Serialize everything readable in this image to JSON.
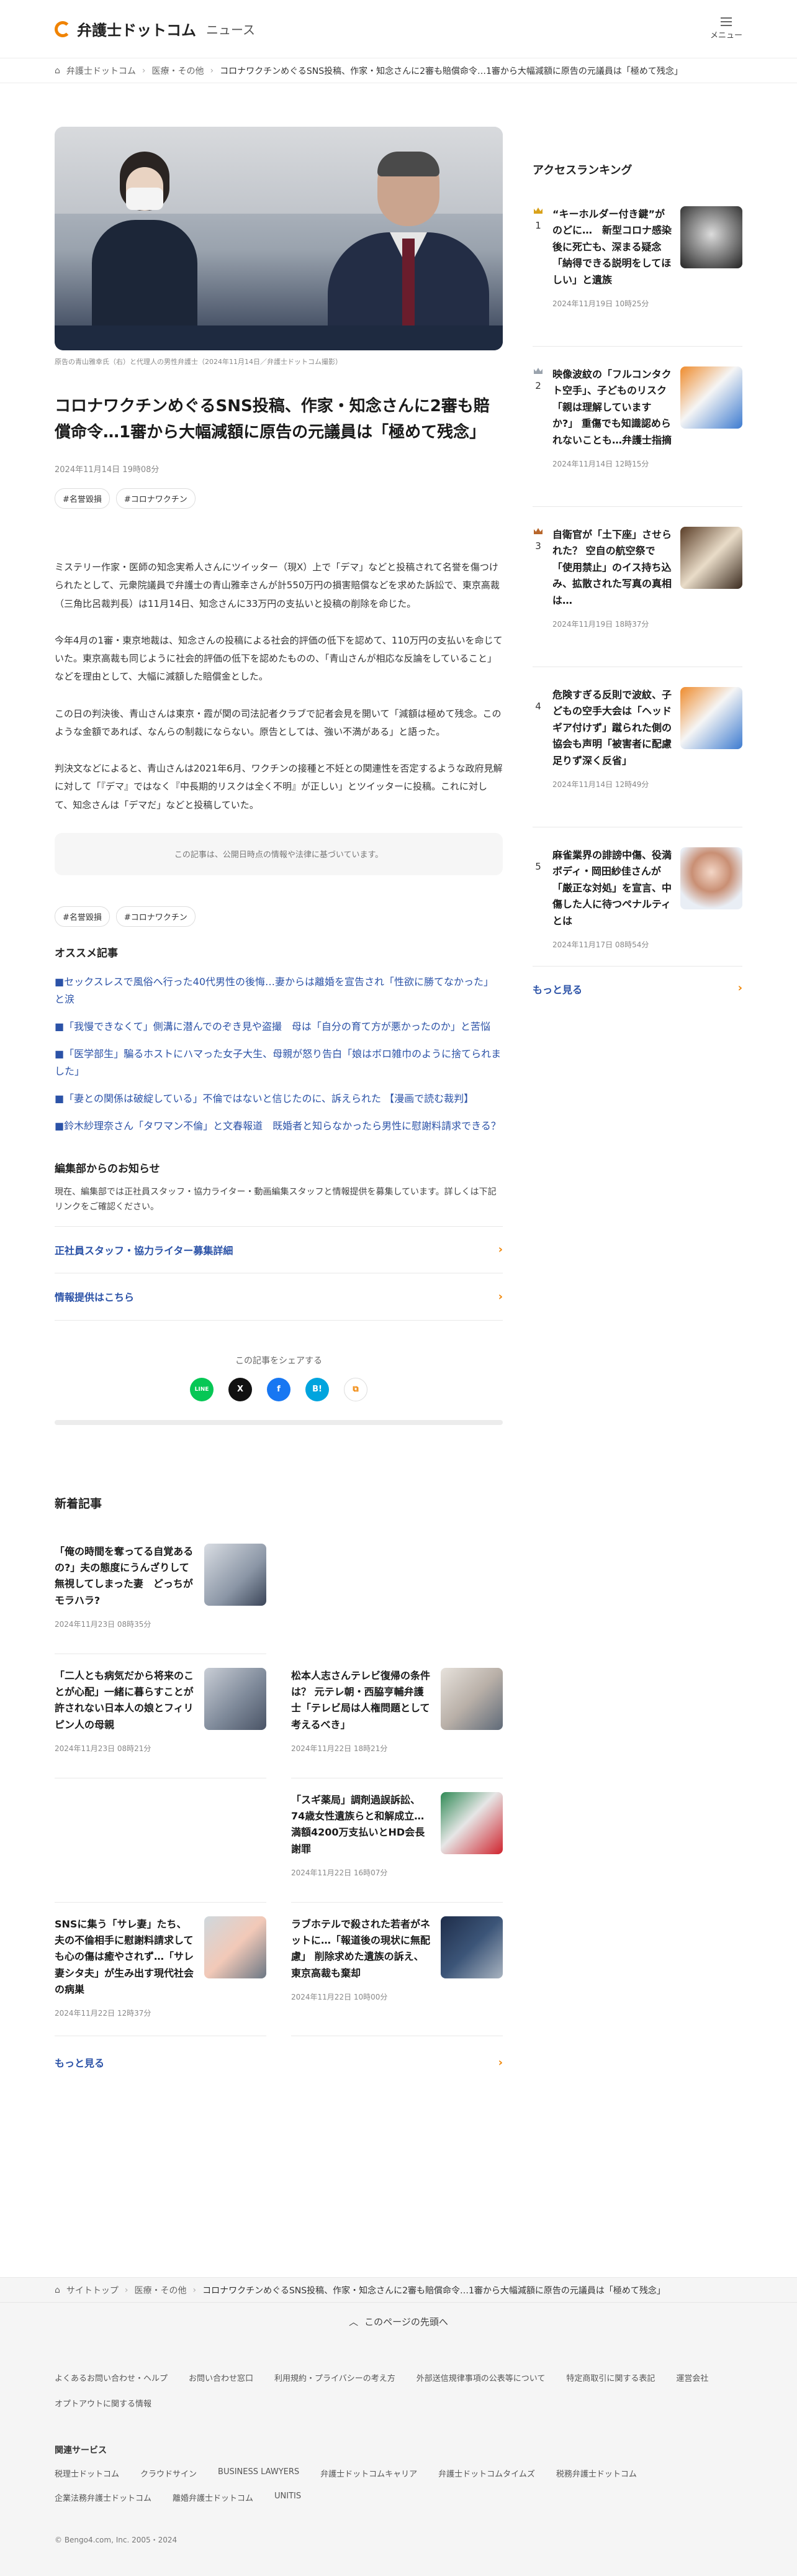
{
  "header": {
    "logo": "弁護士ドットコム",
    "logo_sub": "ニュース",
    "menu_label": "メニュー"
  },
  "breadcrumb": [
    "弁護士ドットコム",
    "医療・その他",
    "コロナワクチンめぐるSNS投稿、作家・知念さんに2審も賠償命令…1審から大幅減額に原告の元議員は「極めて残念」"
  ],
  "article": {
    "caption": "原告の青山雅幸氏（右）と代理人の男性弁護士（2024年11月14日／弁護士ドットコム撮影）",
    "title": "コロナワクチンめぐるSNS投稿、作家・知念さんに2審も賠償命令…1審から大幅減額に原告の元議員は「極めて残念」",
    "date": "2024年11月14日 19時08分",
    "tags": [
      "#名誉毀損",
      "#コロナワクチン"
    ],
    "paragraphs": [
      "ミステリー作家・医師の知念実希人さんにツイッター（現X）上で「デマ」などと投稿されて名誉を傷つけられたとして、元衆院議員で弁護士の青山雅幸さんが計550万円の損害賠償などを求めた訴訟で、東京高裁（三角比呂裁判長）は11月14日、知念さんに33万円の支払いと投稿の削除を命じた。",
      "今年4月の1審・東京地裁は、知念さんの投稿による社会的評価の低下を認めて、110万円の支払いを命じていた。東京高裁も同じように社会的評価の低下を認めたものの、「青山さんが相応な反論をしていること」などを理由として、大幅に減額した賠償金とした。",
      "この日の判決後、青山さんは東京・霞が関の司法記者クラブで記者会見を開いて「減額は極めて残念。このような金額であれば、なんらの制裁にならない。原告としては、強い不満がある」と語った。",
      "判決文などによると、青山さんは2021年6月、ワクチンの接種と不妊との関連性を否定するような政府見解に対して「『デマ』ではなく『中長期的リスクは全く不明』が正しい」とツイッターに投稿。これに対して、知念さんは「デマだ」などと投稿していた。"
    ],
    "notice": "この記事は、公開日時点の情報や法律に基づいています。"
  },
  "recommend": {
    "title": "オススメ記事",
    "items": [
      "■セックスレスで風俗へ行った40代男性の後悔…妻からは離婚を宣告され「性欲に勝てなかった」と涙",
      "■「我慢できなくて」側溝に潜んでのぞき見や盗撮　母は「自分の育て方が悪かったのか」と苦悩",
      "■「医学部生」騙るホストにハマった女子大生、母親が怒り告白「娘はボロ雑巾のように捨てられました」",
      "■「妻との関係は破綻している」不倫ではないと信じたのに、訴えられた 【漫画で読む裁判】",
      "■鈴木紗理奈さん「タワマン不倫」と文春報道　既婚者と知らなかったら男性に慰謝料請求できる？"
    ]
  },
  "editorial": {
    "title": "編集部からのお知らせ",
    "text": "現在、編集部では正社員スタッフ・協力ライター・動画編集スタッフと情報提供を募集しています。詳しくは下記リンクをご確認ください。",
    "links": [
      "正社員スタッフ・協力ライター募集詳細",
      "情報提供はこちら"
    ]
  },
  "share": {
    "label": "この記事をシェアする",
    "icons": [
      "LINE",
      "X",
      "f",
      "B!",
      "⧉"
    ]
  },
  "new_articles": {
    "title": "新着記事",
    "items": [
      {
        "title": "「俺の時間を奪ってる自覚あるの?」夫の態度にうんざりして無視してしまった妻　どっちがモラハラ?",
        "date": "2024年11月23日 08時35分"
      },
      {
        "title": "",
        "date": ""
      },
      {
        "title": "「二人とも病気だから将来のことが心配」一緒に暮らすことが許されない日本人の娘とフィリピン人の母親",
        "date": "2024年11月23日 08時21分"
      },
      {
        "title": "松本人志さんテレビ復帰の条件は？ 元テレ朝・西脇亨輔弁護士「テレビ局は人権問題として考えるべき」",
        "date": "2024年11月22日 18時21分"
      },
      {
        "title": "",
        "date": ""
      },
      {
        "title": "「スギ薬局」調剤過誤訴訟、74歳女性遺族らと和解成立…満額4200万支払いとHD会長謝罪",
        "date": "2024年11月22日 16時07分"
      },
      {
        "title": "SNSに集う「サレ妻」たち、夫の不倫相手に慰謝料請求しても心の傷は癒やされず…「サレ妻シタ夫」が生み出す現代社会の病巣",
        "date": "2024年11月22日 12時37分"
      },
      {
        "title": "ラブホテルで殺された若者がネットに…「報道後の現状に無配慮」 削除求めた遺族の訴え、東京高裁も棄却",
        "date": "2024年11月22日 10時00分"
      }
    ],
    "more": "もっと見る"
  },
  "ranking": {
    "title": "アクセスランキング",
    "items": [
      {
        "rank": "1",
        "title": "“キーホルダー付き鍵”がのどに…　新型コロナ感染後に死亡も、深まる疑念「納得できる説明をしてほしい」と遺族",
        "date": "2024年11月19日 10時25分"
      },
      {
        "rank": "2",
        "title": "映像波紋の「フルコンタクト空手」、子どものリスク「親は理解していますか?」 重傷でも知識認められないことも…弁護士指摘",
        "date": "2024年11月14日 12時15分"
      },
      {
        "rank": "3",
        "title": "自衛官が「土下座」させられた？ 空自の航空祭で「使用禁止」のイス持ち込み、拡散された写真の真相は…",
        "date": "2024年11月19日 18時37分"
      },
      {
        "rank": "4",
        "title": "危険すぎる反則で波紋、子どもの空手大会は「ヘッドギア付けず」蹴られた側の協会も声明「被害者に配慮足りず深く反省」",
        "date": "2024年11月14日 12時49分"
      },
      {
        "rank": "5",
        "title": "麻雀業界の誹謗中傷、役満ボディ・岡田紗佳さんが「厳正な対処」を宣言、中傷した人に待つペナルティとは",
        "date": "2024年11月17日 08時54分"
      }
    ],
    "more": "もっと見る"
  },
  "footer": {
    "breadcrumb": [
      "サイトトップ",
      "医療・その他",
      "コロナワクチンめぐるSNS投稿、作家・知念さんに2審も賠償命令…1審から大幅減額に原告の元議員は「極めて残念」"
    ],
    "pagetop": "このページの先頭へ",
    "links": [
      "よくあるお問い合わせ・ヘルプ",
      "お問い合わせ窓口",
      "利用規約・プライバシーの考え方",
      "外部送信規律事項の公表等について",
      "特定商取引に関する表記",
      "運営会社",
      "オプトアウトに関する情報"
    ],
    "services_title": "関連サービス",
    "services": [
      "税理士ドットコム",
      "クラウドサイン",
      "BUSINESS LAWYERS",
      "弁護士ドットコムキャリア",
      "弁護士ドットコムタイムズ",
      "税務弁護士ドットコム",
      "企業法務弁護士ドットコム",
      "離婚弁護士ドットコム",
      "UNITIS"
    ],
    "copyright": "© Bengo4.com, Inc. 2005・2024"
  },
  "colors": {
    "accent": "#f08300",
    "link": "#2b52a7"
  }
}
